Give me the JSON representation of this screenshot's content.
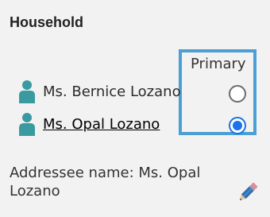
{
  "household": {
    "heading": "Household",
    "primary_header": "Primary",
    "members": [
      {
        "name": "Ms. Bernice Lozano",
        "is_link": false,
        "primary": false,
        "icon": "person-icon"
      },
      {
        "name": "Ms. Opal Lozano",
        "is_link": true,
        "primary": true,
        "icon": "person-icon"
      }
    ],
    "addressee": "Addressee name: Ms. Opal Lozano",
    "edit_icon": "pencil-icon"
  },
  "colors": {
    "accent_border": "#4b9fd5",
    "radio_selected": "#1a73e8",
    "person_icon": "#3a9aa0"
  }
}
